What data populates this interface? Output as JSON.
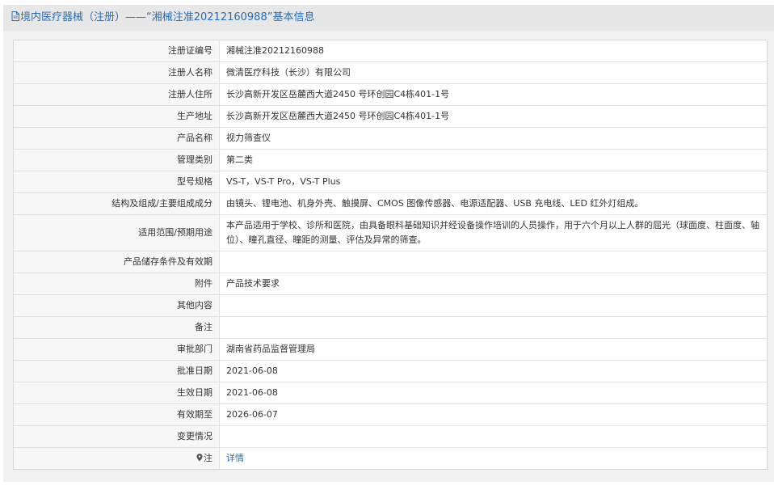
{
  "header": {
    "title": "境内医疗器械（注册）——“湘械注准20212160988”基本信息"
  },
  "rows": [
    {
      "label": "注册证编号",
      "value": "湘械注准20212160988"
    },
    {
      "label": "注册人名称",
      "value": "微清医疗科技（长沙）有限公司"
    },
    {
      "label": "注册人住所",
      "value": "长沙高新开发区岳麓西大道2450 号环创园C4栋401-1号"
    },
    {
      "label": "生产地址",
      "value": "长沙高新开发区岳麓西大道2450 号环创园C4栋401-1号"
    },
    {
      "label": "产品名称",
      "value": "视力筛查仪"
    },
    {
      "label": "管理类别",
      "value": "第二类"
    },
    {
      "label": "型号规格",
      "value": "VS-T，VS-T Pro，VS-T Plus"
    },
    {
      "label": "结构及组成/主要组成成分",
      "value": "由镜头、锂电池、机身外壳、触摸屏、CMOS 图像传感器、电源适配器、USB 充电线、LED 红外灯组成。"
    },
    {
      "label": "适用范围/预期用途",
      "value": "本产品适用于学校、诊所和医院，由具备眼科基础知识并经设备操作培训的人员操作，用于六个月以上人群的屈光（球面度、柱面度、轴位）、瞳孔直径、瞳距的测量、评估及异常的筛查。"
    },
    {
      "label": "产品储存条件及有效期",
      "value": ""
    },
    {
      "label": "附件",
      "value": "产品技术要求"
    },
    {
      "label": "其他内容",
      "value": ""
    },
    {
      "label": "备注",
      "value": ""
    },
    {
      "label": "审批部门",
      "value": "湖南省药品监督管理局"
    },
    {
      "label": "批准日期",
      "value": "2021-06-08"
    },
    {
      "label": "生效日期",
      "value": "2021-06-08"
    },
    {
      "label": "有效期至",
      "value": "2026-06-07"
    },
    {
      "label": "变更情况",
      "value": ""
    }
  ],
  "note": {
    "label": "注",
    "link": "详情",
    "icon": "map-pin-icon"
  },
  "colors": {
    "accent": "#2a6db3",
    "header_bg": "#e7e7e7",
    "label_bg": "#f7f7f7"
  }
}
